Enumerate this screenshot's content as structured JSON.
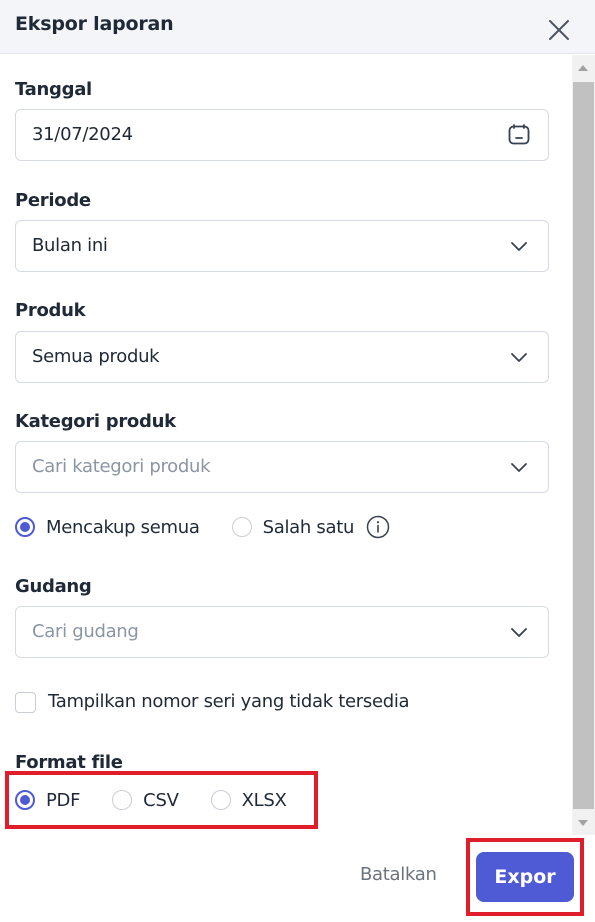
{
  "dialog": {
    "title": "Ekspor laporan",
    "close_icon": "close-icon"
  },
  "fields": {
    "tanggal": {
      "label": "Tanggal",
      "value": "31/07/2024",
      "icon": "calendar-icon"
    },
    "periode": {
      "label": "Periode",
      "value": "Bulan ini"
    },
    "produk": {
      "label": "Produk",
      "value": "Semua produk"
    },
    "kategori": {
      "label": "Kategori produk",
      "placeholder": "Cari kategori produk",
      "match_options": [
        {
          "label": "Mencakup semua",
          "selected": true
        },
        {
          "label": "Salah satu",
          "selected": false,
          "info_icon": "info-icon"
        }
      ]
    },
    "gudang": {
      "label": "Gudang",
      "placeholder": "Cari gudang"
    },
    "serial_checkbox": {
      "label": "Tampilkan nomor seri yang tidak tersedia",
      "checked": false
    },
    "format_file": {
      "label": "Format file",
      "options": [
        {
          "label": "PDF",
          "selected": true
        },
        {
          "label": "CSV",
          "selected": false
        },
        {
          "label": "XLSX",
          "selected": false
        }
      ]
    }
  },
  "footer": {
    "cancel_label": "Batalkan",
    "export_label": "Expor"
  },
  "colors": {
    "accent": "#4f5bd5",
    "highlight": "#e01e2b"
  }
}
